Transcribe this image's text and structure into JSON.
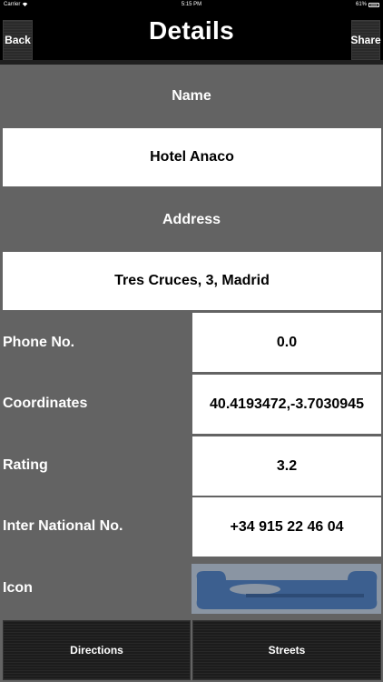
{
  "status_bar": {
    "carrier": "Carrier",
    "time": "5:15 PM",
    "battery_text": "61%",
    "wifi_icon": "wifi-icon",
    "battery_icon": "battery-icon"
  },
  "nav": {
    "back_label": "Back",
    "title": "Details",
    "share_label": "Share"
  },
  "name": {
    "label": "Name",
    "value": "Hotel Anaco"
  },
  "address": {
    "label": "Address",
    "value": "Tres Cruces, 3, Madrid"
  },
  "rows": [
    {
      "label": "Phone No.",
      "value": "0.0"
    },
    {
      "label": "Coordinates",
      "value": "40.4193472,-3.7030945"
    },
    {
      "label": "Rating",
      "value": "3.2"
    },
    {
      "label": "Inter National No.",
      "value": "+34 915 22 46 04"
    }
  ],
  "icon_row": {
    "label": "Icon",
    "image": "hotel-icon-image"
  },
  "bottom": {
    "directions_label": "Directions",
    "streets_label": "Streets"
  },
  "colors": {
    "background": "#636363",
    "bar": "#000000",
    "box": "#ffffff",
    "icon_blue": "#3c5f8f"
  }
}
